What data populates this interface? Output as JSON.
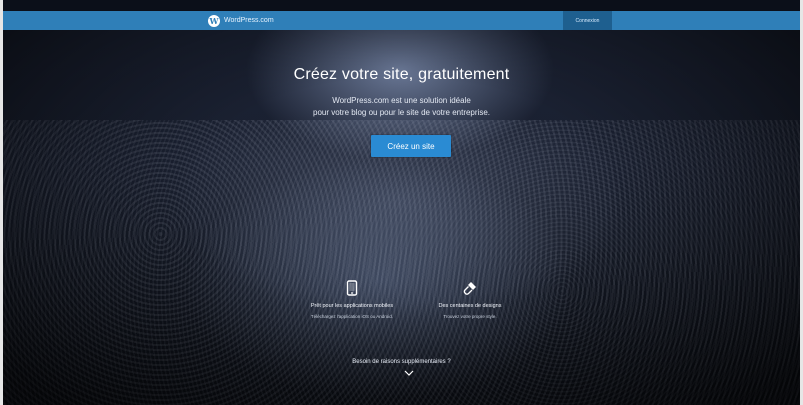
{
  "header": {
    "brand": "WordPress.com",
    "login_label": "Connexion"
  },
  "hero": {
    "headline": "Créez votre site, gratuitement",
    "subtitle_line1": "WordPress.com est une solution idéale",
    "subtitle_line2": "pour votre blog ou pour le site de votre entreprise.",
    "cta_label": "Créez un site"
  },
  "features": [
    {
      "icon": "tablet-icon",
      "title": "Prêt pour les applications mobiles",
      "description": "Téléchargez l'application iOS ou Android."
    },
    {
      "icon": "brush-icon",
      "title": "Des centaines de designs",
      "description": "Trouvez votre propre style."
    }
  ],
  "footer": {
    "more_label": "Besoin de raisons supplémentaires ?"
  },
  "colors": {
    "topbar": "#2f7fb8",
    "login_button": "#1e5f8f",
    "cta": "#2a8bd3"
  }
}
